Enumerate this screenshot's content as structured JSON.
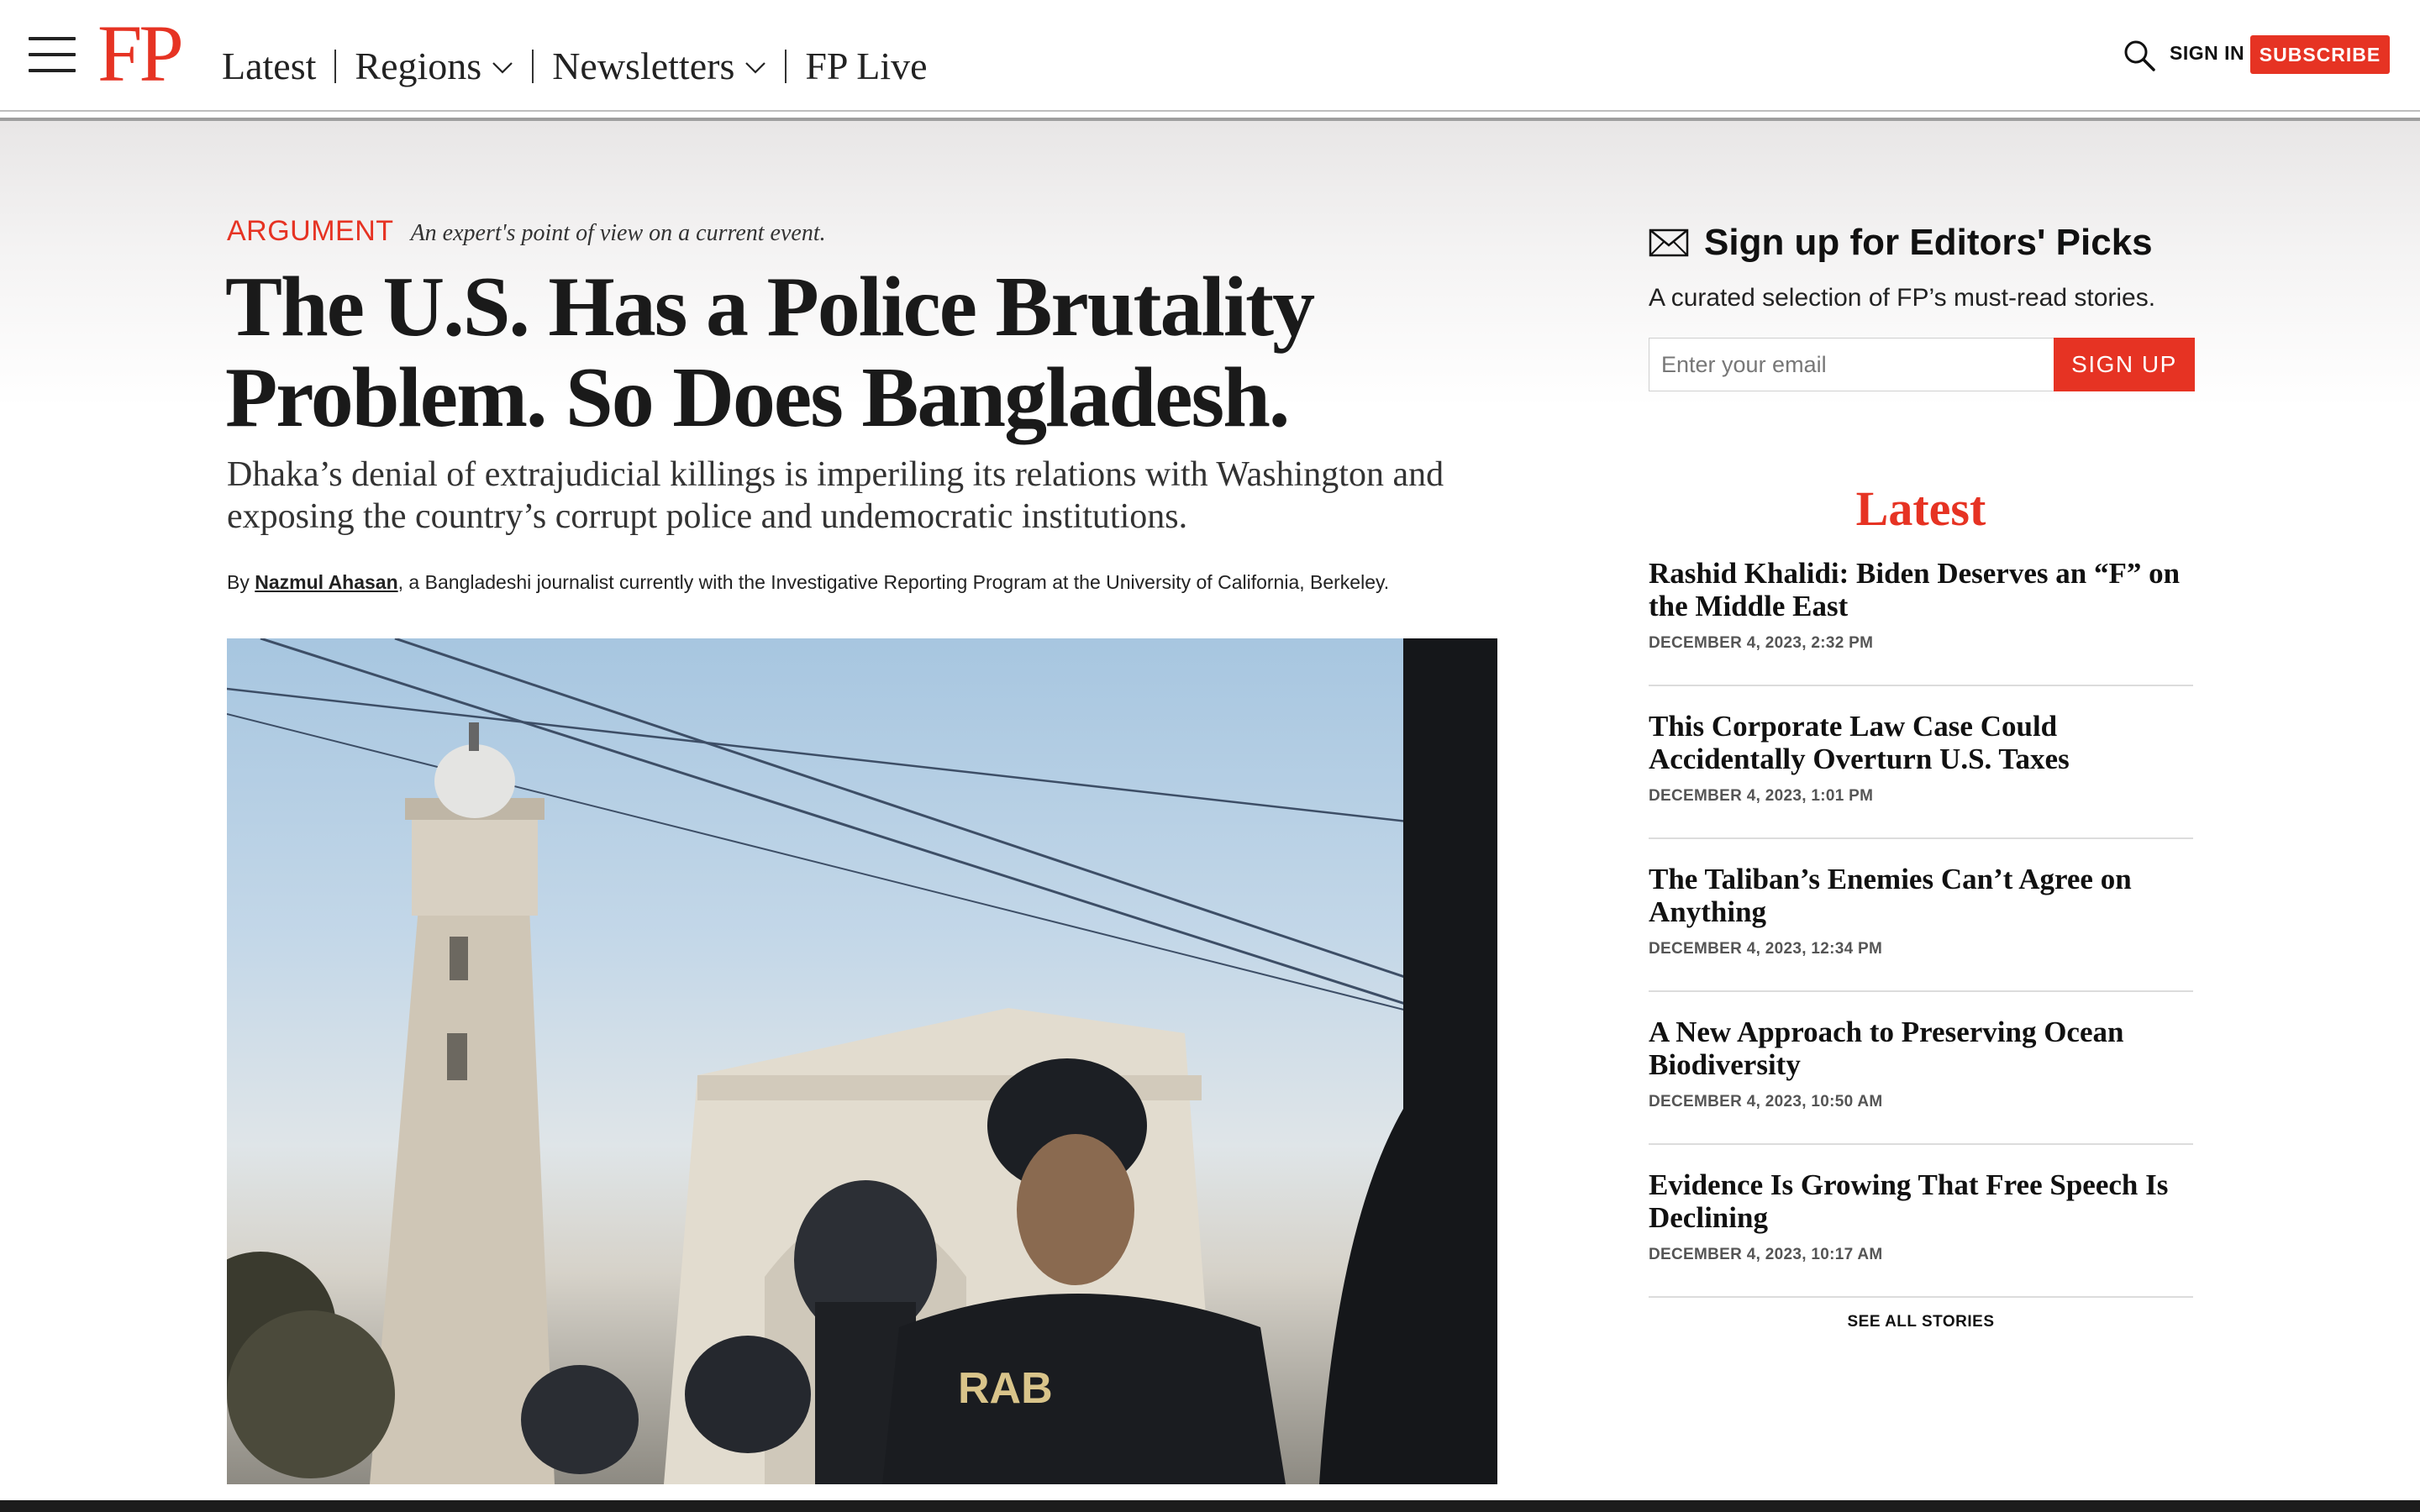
{
  "header": {
    "logo": "FP",
    "nav": [
      {
        "label": "Latest",
        "dropdown": false
      },
      {
        "label": "Regions",
        "dropdown": true
      },
      {
        "label": "Newsletters",
        "dropdown": true
      },
      {
        "label": "FP Live",
        "dropdown": false
      }
    ],
    "signin_label": "SIGN IN",
    "subscribe_label": "SUBSCRIBE"
  },
  "article": {
    "kicker_label": "ARGUMENT",
    "kicker_desc": "An expert's point of view on a current event.",
    "headline": "The U.S. Has a Police Brutality Problem. So Does Bangladesh.",
    "dek": "Dhaka’s denial of extrajudicial killings is imperiling its relations with Washington and exposing the country’s corrupt police and undemocratic institutions.",
    "byline_prefix": "By ",
    "author": "Nazmul Ahasan",
    "byline_suffix": ", a Bangladeshi journalist currently with the Investigative Reporting Program at the University of California, Berkeley.",
    "photo_text": "RAB"
  },
  "sidebar": {
    "signup_title": "Sign up for Editors' Picks",
    "signup_sub": "A curated selection of FP’s must-read stories.",
    "email_placeholder": "Enter your email",
    "signup_button": "SIGN UP",
    "latest_heading": "Latest",
    "stories": [
      {
        "title": "Rashid Khalidi: Biden Deserves an “F” on the Middle East",
        "date": "DECEMBER 4, 2023, 2:32 PM"
      },
      {
        "title": "This Corporate Law Case Could Accidentally Overturn U.S. Taxes",
        "date": "DECEMBER 4, 2023, 1:01 PM"
      },
      {
        "title": "The Taliban’s Enemies Can’t Agree on Anything",
        "date": "DECEMBER 4, 2023, 12:34 PM"
      },
      {
        "title": "A New Approach to Preserving Ocean Biodiversity",
        "date": "DECEMBER 4, 2023, 10:50 AM"
      },
      {
        "title": "Evidence Is Growing That Free Speech Is Declining",
        "date": "DECEMBER 4, 2023, 10:17 AM"
      }
    ],
    "see_all": "SEE ALL STORIES"
  },
  "colors": {
    "brand_red": "#e63323",
    "text_dark": "#111111"
  }
}
